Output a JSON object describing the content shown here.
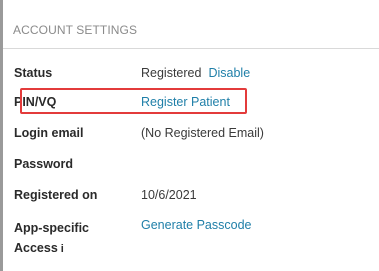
{
  "section": {
    "title": "ACCOUNT SETTINGS"
  },
  "rows": {
    "status": {
      "label": "Status",
      "value": "Registered",
      "action": "Disable"
    },
    "pin": {
      "label": "PIN/VQ",
      "action": "Register Patient"
    },
    "login_email": {
      "label": "Login email",
      "value": "(No Registered Email)"
    },
    "password": {
      "label": "Password"
    },
    "registered_on": {
      "label": "Registered on",
      "value": "10/6/2021"
    },
    "app_access": {
      "label_line1": "App-specific",
      "label_line2": "Access",
      "info_glyph": "i",
      "action": "Generate Passcode"
    }
  },
  "colors": {
    "link": "#1f7fa8",
    "highlight": "#e33b3b",
    "header_text": "#8a8a8a"
  }
}
